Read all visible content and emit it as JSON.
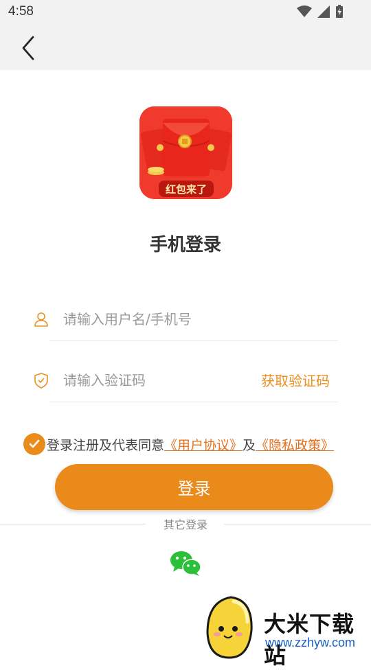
{
  "status_bar": {
    "time": "4:58"
  },
  "app": {
    "logo_text": "红包来了"
  },
  "page": {
    "title": "手机登录"
  },
  "form": {
    "username_placeholder": "请输入用户名/手机号",
    "code_placeholder": "请输入验证码",
    "get_code_label": "获取验证码"
  },
  "agreement": {
    "checked": true,
    "prefix": "登录注册及代表同意",
    "user_agreement": "《用户协议》",
    "conjunction": "及",
    "privacy_policy": "《隐私政策》"
  },
  "login_button": {
    "label": "登录"
  },
  "other_login": {
    "label": "其它登录",
    "methods": [
      "wechat"
    ]
  },
  "watermark": {
    "title": "大米下载站",
    "url": "www.zzhyw.com"
  },
  "colors": {
    "accent": "#e98a1a",
    "link": "#e8701c",
    "logo_red": "#f03a2e",
    "wechat_green": "#2bbf3a"
  }
}
